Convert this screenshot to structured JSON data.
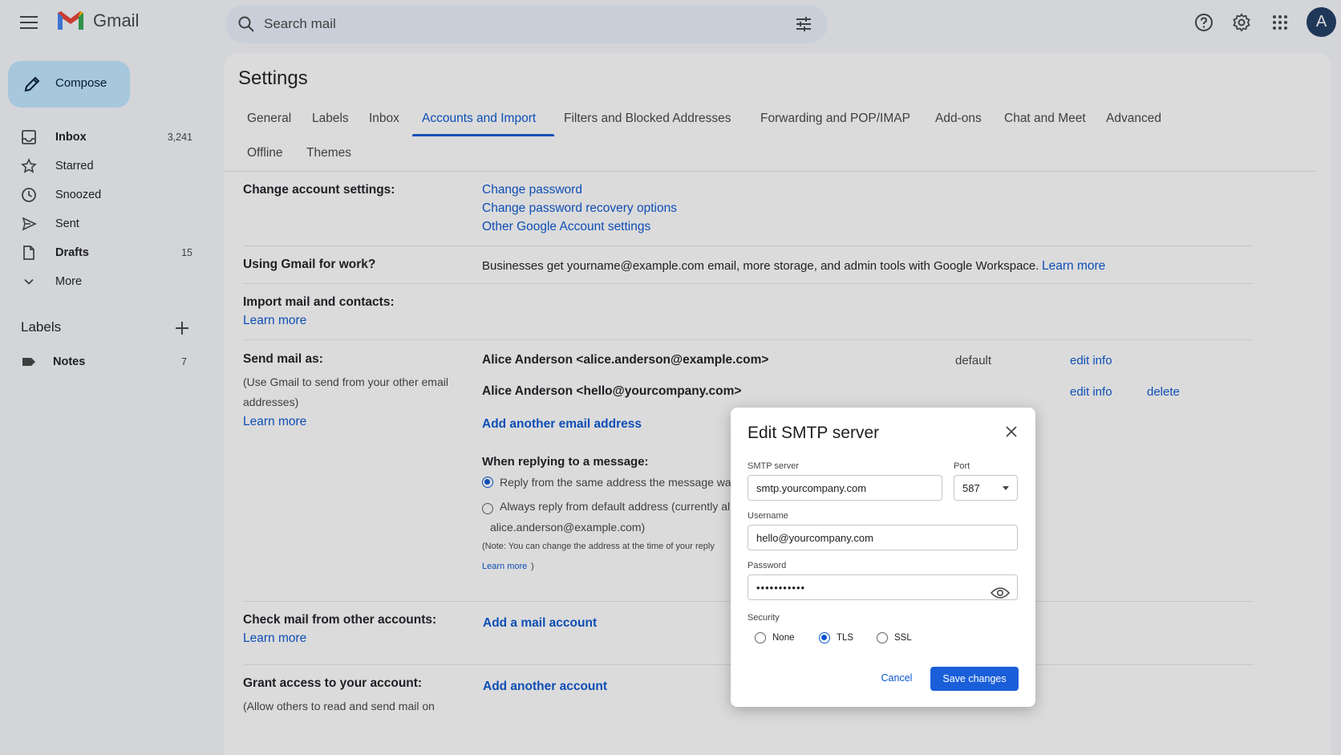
{
  "app": {
    "name": "Gmail",
    "avatar_letter": "A"
  },
  "search": {
    "placeholder": "Search mail"
  },
  "sidebar": {
    "compose_label": "Compose",
    "items": [
      {
        "label": "Inbox",
        "count": "3,241",
        "icon": "inbox-icon",
        "bold": true
      },
      {
        "label": "Starred",
        "count": "",
        "icon": "star-icon",
        "bold": false
      },
      {
        "label": "Snoozed",
        "count": "",
        "icon": "clock-icon",
        "bold": false
      },
      {
        "label": "Sent",
        "count": "",
        "icon": "send-icon",
        "bold": false
      },
      {
        "label": "Drafts",
        "count": "15",
        "icon": "draft-icon",
        "bold": true
      },
      {
        "label": "More",
        "count": "",
        "icon": "chevron-down-icon",
        "bold": false
      }
    ],
    "labels_heading": "Labels",
    "labels": [
      {
        "label": "Notes",
        "count": "7"
      }
    ]
  },
  "settings": {
    "title": "Settings",
    "tabs": [
      "General",
      "Labels",
      "Inbox",
      "Accounts and Import",
      "Filters and Blocked Addresses",
      "Forwarding and POP/IMAP",
      "Add-ons",
      "Chat and Meet",
      "Advanced",
      "Offline",
      "Themes"
    ],
    "active_tab": "Accounts and Import",
    "change_account": {
      "title": "Change account settings:",
      "links": [
        "Change password",
        "Change password recovery options",
        "Other Google Account settings"
      ]
    },
    "gmail_work": {
      "title": "Using Gmail for work?",
      "text": "Businesses get yourname@example.com email, more storage, and admin tools with Google Workspace.",
      "link": "Learn more"
    },
    "import": {
      "title": "Import mail and contacts:",
      "link": "Learn more"
    },
    "send_as": {
      "title": "Send mail as:",
      "desc_line1": "(Use Gmail to send from your other email",
      "desc_line2": "addresses)",
      "learn_more": "Learn more",
      "addresses": [
        {
          "address": "Alice Anderson <alice.anderson@example.com>",
          "status": "default",
          "edit": "edit info",
          "delete": ""
        },
        {
          "address": "Alice Anderson <hello@yourcompany.com>",
          "status": "",
          "edit": "edit info",
          "delete": "delete"
        }
      ],
      "add_link": "Add another email address",
      "reply_title": "When replying to a message:",
      "reply_option1": "Reply from the same address the message was s",
      "reply_option2": "Always reply from default address (currently ali",
      "reply_option2_cont": "alice.anderson@example.com)",
      "note": "(Note: You can change the address at the time of your reply",
      "note_link": "Learn more",
      "note_close": ")"
    },
    "check_mail": {
      "title": "Check mail from other accounts:",
      "learn_more": "Learn more",
      "link": "Add a mail account"
    },
    "grant_access": {
      "title": "Grant access to your account:",
      "desc": "(Allow others to read and send mail on",
      "link": "Add another account"
    }
  },
  "dialog": {
    "title": "Edit SMTP server",
    "smtp_label": "SMTP server",
    "smtp_value": "smtp.yourcompany.com",
    "port_label": "Port",
    "port_value": "587",
    "username_label": "Username",
    "username_value": "hello@yourcompany.com",
    "password_label": "Password",
    "password_value": "•••••••••••",
    "security_label": "Security",
    "security_options": [
      "None",
      "TLS",
      "SSL"
    ],
    "security_selected": "TLS",
    "cancel_label": "Cancel",
    "save_label": "Save changes"
  },
  "colors": {
    "accent": "#0b57d0",
    "compose_bg": "#c2e7ff",
    "save_button": "#1a5fd9"
  }
}
